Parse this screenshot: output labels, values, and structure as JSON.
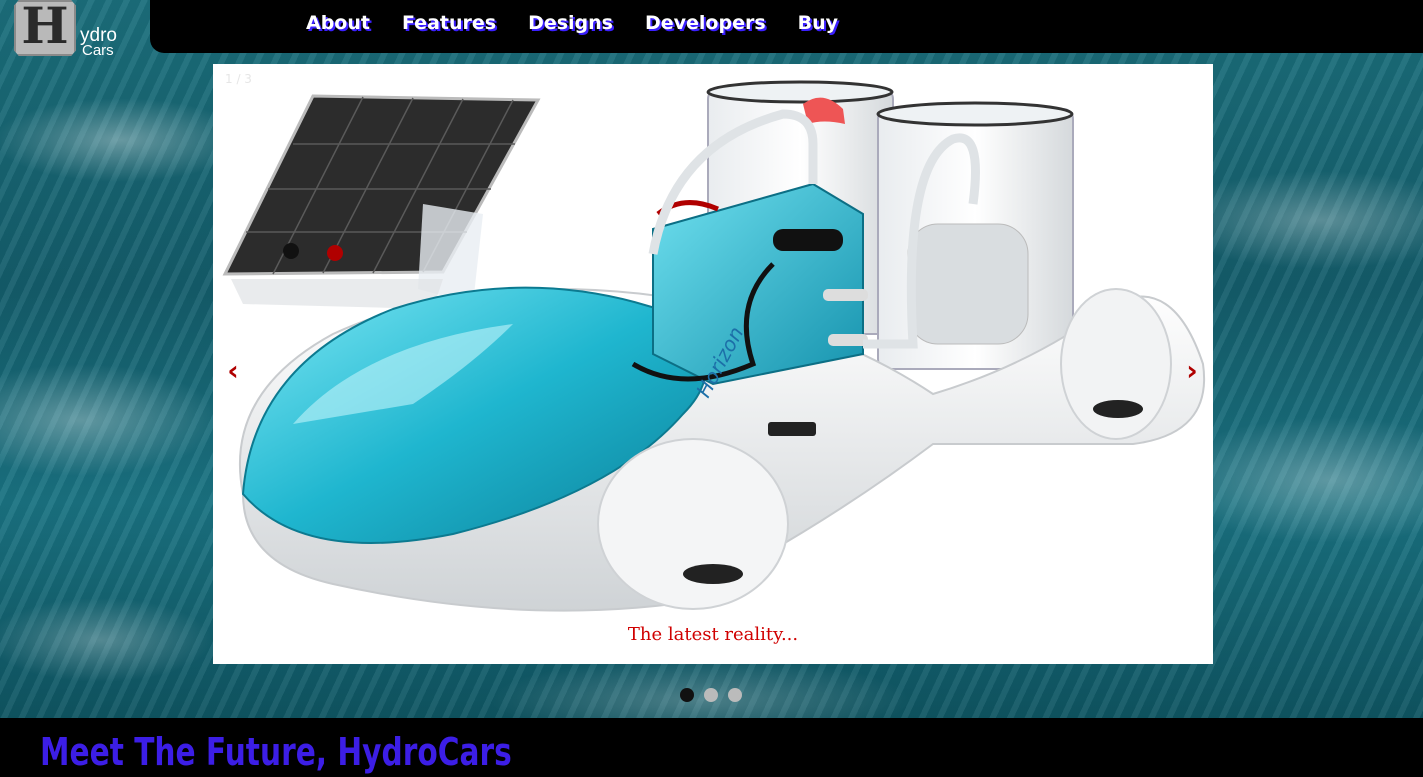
{
  "brand": {
    "letter": "H",
    "word1": "ydro",
    "word2": "Cars"
  },
  "nav": {
    "items": [
      "About",
      "Features",
      "Designs",
      "Developers",
      "Buy"
    ]
  },
  "slideshow": {
    "counter": "1 / 3",
    "caption": "The latest reality...",
    "prev_label": "‹",
    "next_label": "›",
    "total": 3,
    "active_index": 0
  },
  "headline": "Meet The Future, HydroCars",
  "colors": {
    "nav_shadow": "#3b1fff",
    "caption": "#d00000",
    "headline": "#3c1ee6",
    "arrow": "#b00000"
  }
}
